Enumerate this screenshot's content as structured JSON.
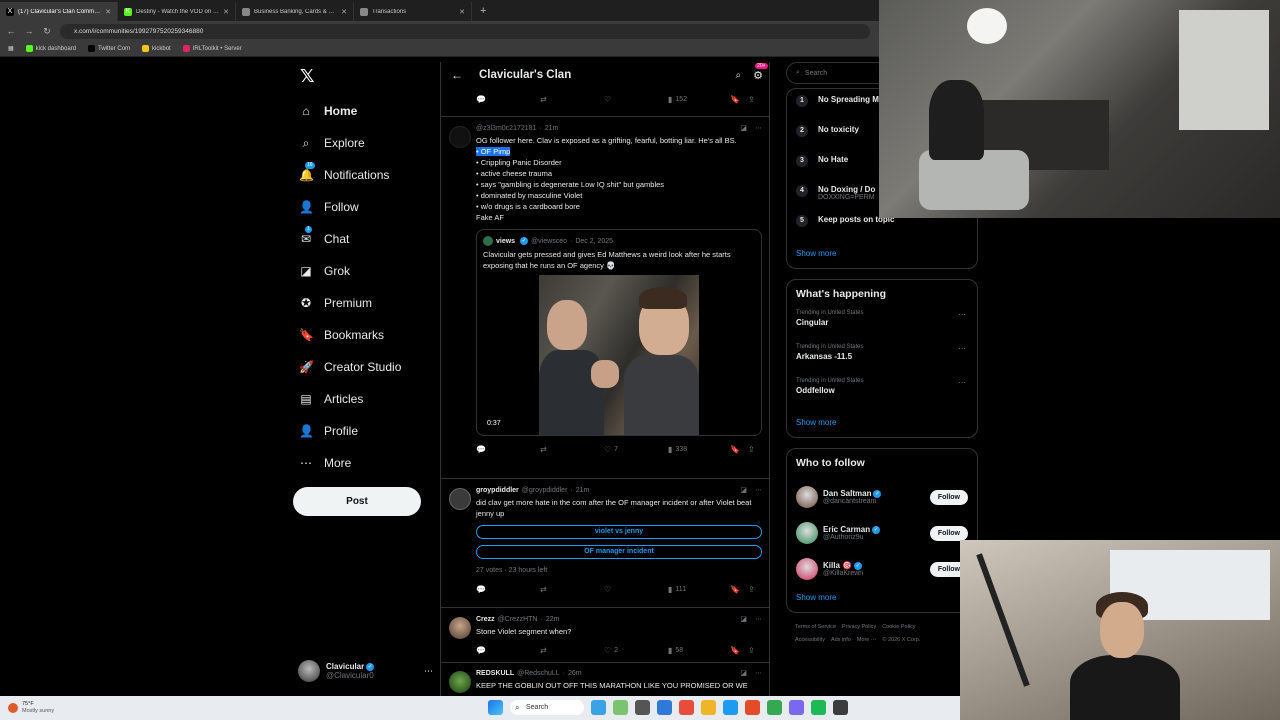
{
  "browser": {
    "tabs": [
      {
        "title": "(17) Clavicular's Clan Communi...",
        "fav": "#000000",
        "glyph": "X",
        "active": true
      },
      {
        "title": "Destiny - Watch the VOD on Ki...",
        "fav": "#53fc18",
        "glyph": "K",
        "active": false
      },
      {
        "title": "Business Banking, Cards & Trea...",
        "fav": "#888888",
        "glyph": "",
        "active": false
      },
      {
        "title": "Transactions",
        "fav": "#888888",
        "glyph": "",
        "active": false
      }
    ],
    "url": "x.com/i/communities/1992797520259346880",
    "bookmarks": [
      {
        "label": "kick dashboard",
        "color": "#53fc18"
      },
      {
        "label": "Twitter Com",
        "color": "#000000"
      },
      {
        "label": "kickbot",
        "color": "#f5c518"
      },
      {
        "label": "IRLToolkit • Server",
        "color": "#e0245e"
      }
    ]
  },
  "nav": {
    "items": [
      {
        "label": "Home",
        "icon": "home-icon",
        "glyph": "⌂",
        "bold": true
      },
      {
        "label": "Explore",
        "icon": "search-icon",
        "glyph": "⌕",
        "bold": false
      },
      {
        "label": "Notifications",
        "icon": "bell-icon",
        "glyph": "🔔",
        "bold": false,
        "badge": "16"
      },
      {
        "label": "Follow",
        "icon": "add-person-icon",
        "glyph": "👤",
        "bold": false
      },
      {
        "label": "Chat",
        "icon": "mail-icon",
        "glyph": "✉",
        "bold": false,
        "badge": "1"
      },
      {
        "label": "Grok",
        "icon": "grok-icon",
        "glyph": "◪",
        "bold": false
      },
      {
        "label": "Premium",
        "icon": "premium-icon",
        "glyph": "✪",
        "bold": false
      },
      {
        "label": "Bookmarks",
        "icon": "bookmark-icon",
        "glyph": "🔖",
        "bold": false
      },
      {
        "label": "Creator Studio",
        "icon": "rocket-icon",
        "glyph": "🚀",
        "bold": false
      },
      {
        "label": "Articles",
        "icon": "article-icon",
        "glyph": "▤",
        "bold": false
      },
      {
        "label": "Profile",
        "icon": "person-icon",
        "glyph": "👤",
        "bold": false
      },
      {
        "label": "More",
        "icon": "more-icon",
        "glyph": "⋯",
        "bold": false
      }
    ],
    "post_label": "Post",
    "account": {
      "name": "Clavicular",
      "handle": "@Clavicular0"
    }
  },
  "community": {
    "title": "Clavicular's Clan",
    "notif_badge": "20+"
  },
  "posts": {
    "prev_actions": {
      "views": "152"
    },
    "p1": {
      "handle": "@z3l3m0c2172181",
      "time": "21m",
      "text_intro": "OG follower here. Clav is exposed as a grifting, fearful, botting liar. He's all BS.",
      "selected_line": "• OF Pimp",
      "bullets": [
        "• Crippling Panic Disorder",
        "• active cheese trauma",
        "• says \"gambling is degenerate Low IQ shit\" but gambles",
        "• dominated by masculine Violet",
        "• w/o drugs is a cardboard bore",
        "Fake AF"
      ],
      "quote": {
        "name": "views",
        "handle": "@viewsceo",
        "date": "Dec 2, 2025",
        "text": "Clavicular gets pressed and gives Ed Matthews a weird look after he starts exposing that he runs an OF agency 💀",
        "duration": "0:37"
      },
      "likes": "7",
      "views": "338"
    },
    "p2": {
      "name": "groypdiddler",
      "handle": "@groypdiddler",
      "time": "21m",
      "text": "did clav get more hate in the com after the OF manager incident or after Violet beat jenny up",
      "poll": [
        "violet vs jenny",
        "OF manager incident"
      ],
      "poll_info": "27 votes · 23 hours left",
      "views": "111"
    },
    "p3": {
      "name": "Crezz",
      "handle": "@CrezzHTN",
      "time": "22m",
      "text": "Stone Violet segment when?",
      "likes": "2",
      "views": "58"
    },
    "p4": {
      "name": "REDSKULL",
      "handle": "@RedschuLL",
      "time": "26m",
      "text": "KEEP THE GOBLIN OUT OFF THIS MARATHON LIKE YOU PROMISED OR WE"
    }
  },
  "right": {
    "search_placeholder": "Search",
    "rules": [
      {
        "num": "1",
        "title": "No Spreading M",
        "sub": ""
      },
      {
        "num": "2",
        "title": "No toxicity",
        "sub": ""
      },
      {
        "num": "3",
        "title": "No Hate",
        "sub": ""
      },
      {
        "num": "4",
        "title": "No Doxing / Do",
        "sub": "DOXXING=PERM"
      },
      {
        "num": "5",
        "title": "Keep posts on topic",
        "sub": ""
      }
    ],
    "show_more": "Show more",
    "happening_title": "What's happening",
    "trends": [
      {
        "context": "Trending in United States",
        "name": "Cingular"
      },
      {
        "context": "Trending in United States",
        "name": "Arkansas -11.5"
      },
      {
        "context": "Trending in United States",
        "name": "Oddfellow"
      }
    ],
    "wtf_title": "Who to follow",
    "follow_label": "Follow",
    "who_to_follow": [
      {
        "name": "Dan Saltman",
        "handle": "@dancantstream",
        "color": "#6b4a3a"
      },
      {
        "name": "Eric Carman",
        "handle": "@Authoriz9u",
        "color": "#2e8b57"
      },
      {
        "name": "Killa 🎯",
        "handle": "@KillaKrewn",
        "color": "#d02a5c"
      }
    ],
    "footer": [
      "Terms of Service",
      "Privacy Policy",
      "Cookie Policy",
      "Accessibility",
      "Ads info",
      "More ⋯",
      "© 2026 X Corp."
    ]
  },
  "taskbar": {
    "temp": "75°F",
    "condition": "Mostly sunny",
    "search": "Search",
    "apps": [
      "#3aa3e3",
      "#7cc36f",
      "#555555",
      "#2f7ad9",
      "#e74c3c",
      "#f0b429",
      "#1d9bf0",
      "#e34c26",
      "#34a853",
      "#7b68ee",
      "#1db954",
      "#3c3c3c"
    ]
  },
  "colors": {
    "accent": "#1d9bf0",
    "bg": "#000000",
    "border": "#2f3336",
    "muted": "#71767b"
  }
}
